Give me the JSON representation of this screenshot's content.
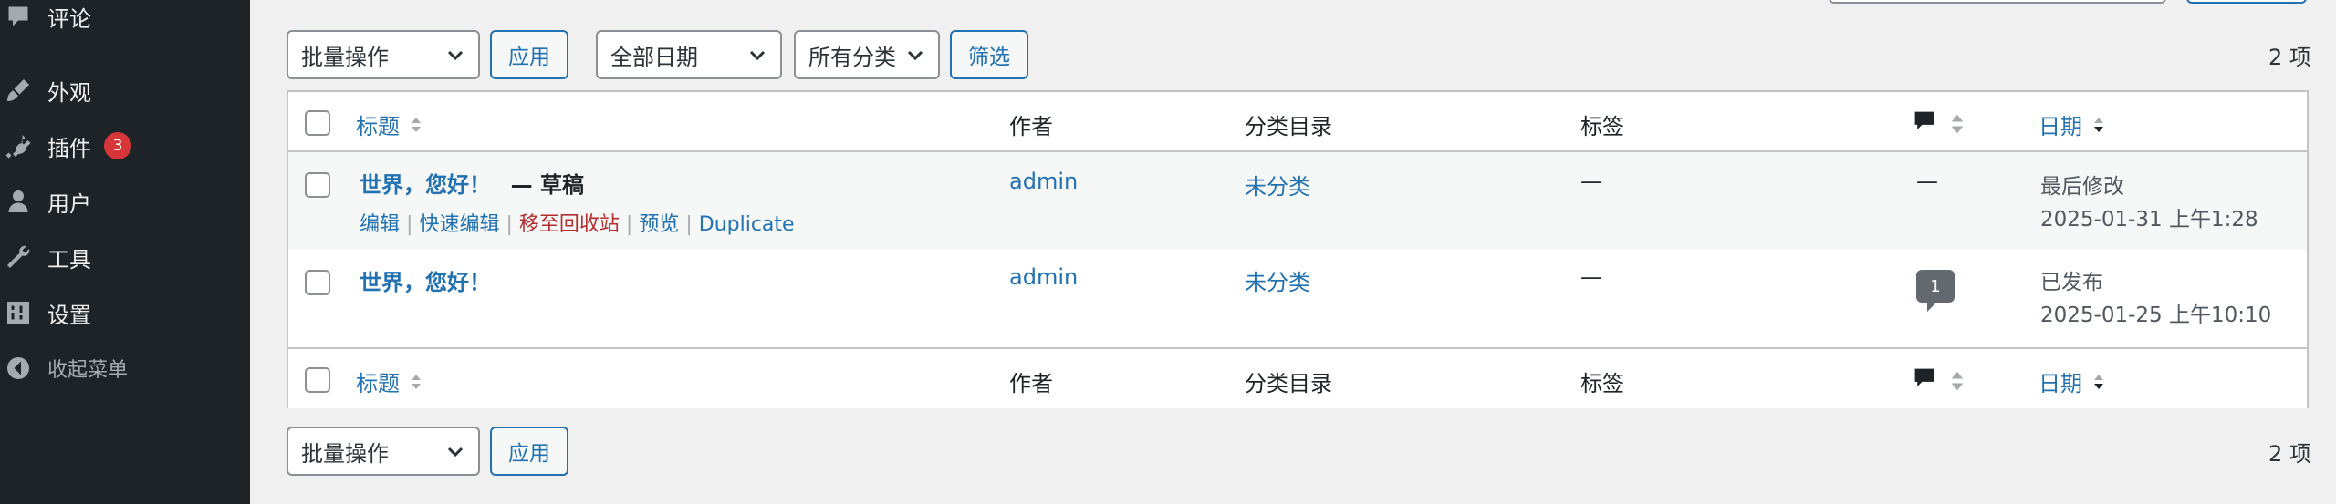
{
  "sidebar": {
    "items": [
      {
        "label": "评论",
        "icon": "comment-icon"
      },
      {
        "label": "外观",
        "icon": "appearance-icon"
      },
      {
        "label": "插件",
        "icon": "plugin-icon",
        "badge": "3"
      },
      {
        "label": "用户",
        "icon": "user-icon"
      },
      {
        "label": "工具",
        "icon": "wrench-icon"
      },
      {
        "label": "设置",
        "icon": "settings-icon"
      },
      {
        "label": "收起菜单",
        "icon": "collapse-icon"
      }
    ]
  },
  "toolbar_top": {
    "bulk_action": "批量操作",
    "apply": "应用",
    "date_filter": "全部日期",
    "category_filter": "所有分类",
    "filter": "筛选",
    "count": "2 项"
  },
  "toolbar_bottom": {
    "bulk_action": "批量操作",
    "apply": "应用",
    "count": "2 项"
  },
  "columns": {
    "title": "标题",
    "author": "作者",
    "categories": "分类目录",
    "tags": "标签",
    "date": "日期"
  },
  "rows": [
    {
      "title": "世界，您好！",
      "state": "— 草稿",
      "actions": {
        "edit": "编辑",
        "quick_edit": "快速编辑",
        "trash": "移至回收站",
        "preview": "预览",
        "duplicate": "Duplicate",
        "sep": "|"
      },
      "author": "admin",
      "category": "未分类",
      "tags": "—",
      "comments": "—",
      "date_status": "最后修改",
      "date": "2025-01-31 上午1:28"
    },
    {
      "title": "世界，您好！",
      "author": "admin",
      "category": "未分类",
      "tags": "—",
      "comments": "1",
      "date_status": "已发布",
      "date": "2025-01-25 上午10:10"
    }
  ],
  "colors": {
    "accent": "#2271b1",
    "sidebar_bg": "#1d2327",
    "danger": "#b32d2e",
    "badge": "#d63638"
  }
}
